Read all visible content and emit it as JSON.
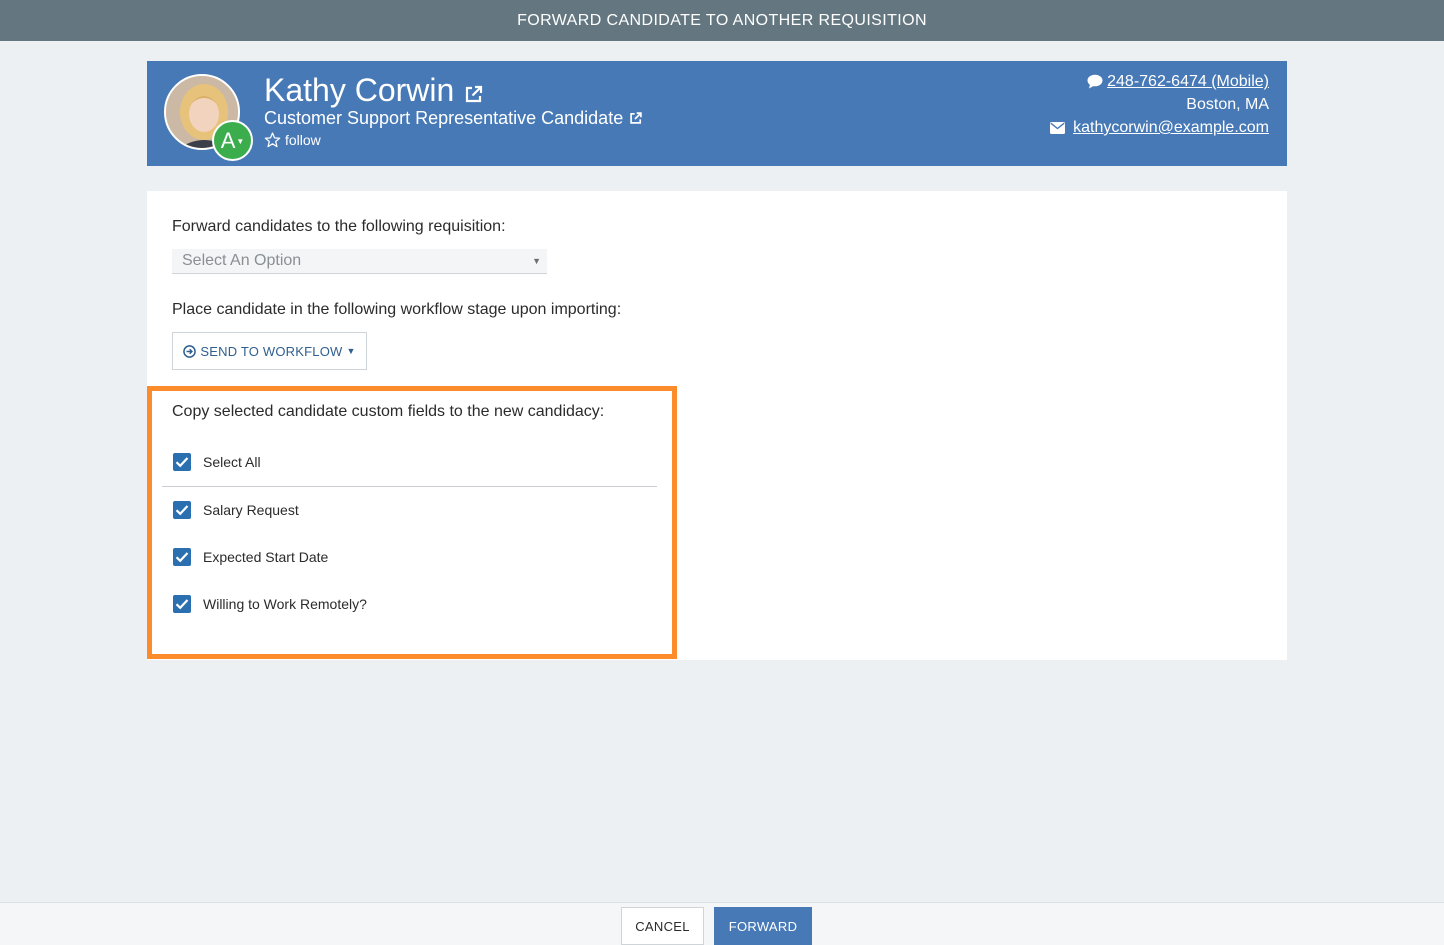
{
  "dialog": {
    "title": "FORWARD CANDIDATE TO ANOTHER REQUISITION"
  },
  "candidate": {
    "name": "Kathy Corwin",
    "role": "Customer Support Representative Candidate",
    "grade": "A",
    "follow_label": "follow",
    "phone": "248-762-6474 (Mobile)",
    "location": "Boston, MA",
    "email": "kathycorwin@example.com"
  },
  "form": {
    "requisition_label": "Forward candidates to the following requisition:",
    "requisition_placeholder": "Select An Option",
    "workflow_label": "Place candidate in the following workflow stage upon importing:",
    "workflow_button": "SEND TO WORKFLOW",
    "custom_fields_label": "Copy selected candidate custom fields to the new candidacy:",
    "select_all": {
      "label": "Select All",
      "checked": true
    },
    "custom_fields": [
      {
        "label": "Salary Request",
        "checked": true
      },
      {
        "label": "Expected Start Date",
        "checked": true
      },
      {
        "label": "Willing to Work Remotely?",
        "checked": true
      }
    ]
  },
  "footer": {
    "cancel_label": "CANCEL",
    "forward_label": "FORWARD"
  },
  "colors": {
    "header_blue": "#4779b6",
    "titlebar": "#647780",
    "highlight": "#fb8b2b",
    "grade_green": "#3cad4d",
    "checkbox": "#2a6fb0"
  },
  "icons": [
    "external-link-icon",
    "star-icon",
    "chat-bubble-icon",
    "envelope-icon",
    "circle-arrow-right-icon",
    "check-icon",
    "caret-down-icon"
  ]
}
